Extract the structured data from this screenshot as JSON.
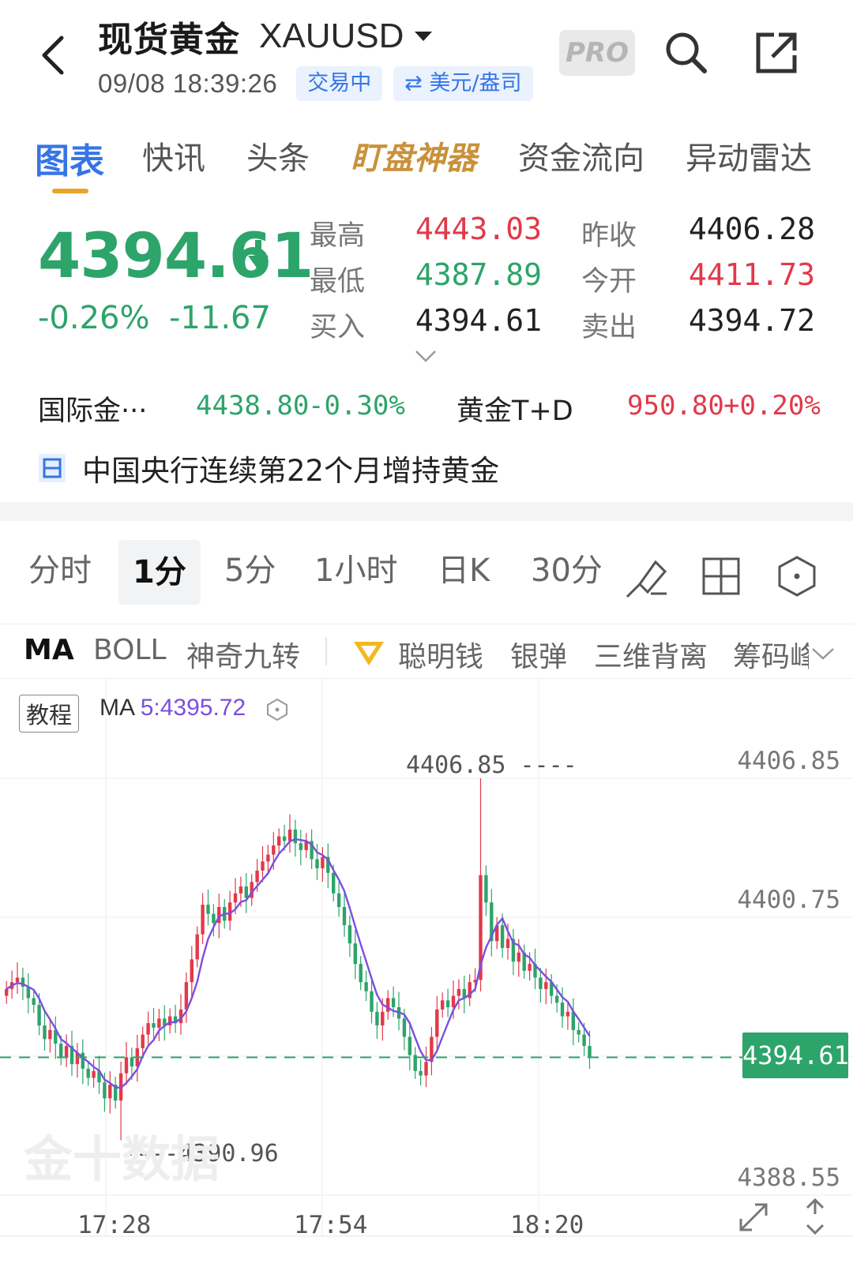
{
  "header": {
    "title": "现货黄金",
    "symbol": "XAUUSD",
    "time": "09/08 18:39:26",
    "status": "交易中",
    "unit": "⇄ 美元/盎司",
    "pro_label": "PRO"
  },
  "tabs": [
    {
      "label": "图表"
    },
    {
      "label": "快讯"
    },
    {
      "label": "头条"
    },
    {
      "label": "盯盘神器"
    },
    {
      "label": "资金流向"
    },
    {
      "label": "异动雷达"
    }
  ],
  "quote": {
    "price": "4394.61",
    "change_pct": "-0.26%",
    "change_abs": "-11.67",
    "stats": [
      {
        "label": "最高",
        "value": "4443.03",
        "color": "#e2394a"
      },
      {
        "label": "最低",
        "value": "4387.89",
        "color": "#2da46a"
      },
      {
        "label": "买入",
        "value": "4394.61",
        "color": "#222222"
      },
      {
        "label": "昨收",
        "value": "4406.28",
        "color": "#222222"
      },
      {
        "label": "今开",
        "value": "4411.73",
        "color": "#e2394a"
      },
      {
        "label": "卖出",
        "value": "4394.72",
        "color": "#222222"
      }
    ]
  },
  "related": [
    {
      "name": "国际金···",
      "price": "4438.80",
      "pct": "-0.30%",
      "color": "#2da46a"
    },
    {
      "name": "黄金T+D",
      "price": "950.80",
      "pct": "+0.20%",
      "color": "#e2394a"
    }
  ],
  "news": {
    "text": "中国央行连续第22个月增持黄金"
  },
  "periods": [
    {
      "label": "分时"
    },
    {
      "label": "1分"
    },
    {
      "label": "5分"
    },
    {
      "label": "1小时"
    },
    {
      "label": "日K"
    },
    {
      "label": "30分"
    }
  ],
  "indicators": [
    {
      "label": "MA"
    },
    {
      "label": "BOLL"
    },
    {
      "label": "神奇九转"
    },
    {
      "label": "聪明钱"
    },
    {
      "label": "银弹"
    },
    {
      "label": "三维背离"
    },
    {
      "label": "筹码峰"
    }
  ],
  "chart": {
    "tutorial_label": "教程",
    "ma_prefix": "MA ",
    "ma_value": "5:4395.72",
    "y_labels": [
      "4406.85",
      "4400.75",
      "4388.55"
    ],
    "current_price": "4394.61",
    "high_mark": "4406.85 ----",
    "low_mark": "----4390.96",
    "x_labels": [
      "17:28",
      "17:54",
      "18:20"
    ],
    "watermark": "金十数据"
  },
  "chart_data": {
    "type": "candlestick",
    "title": "",
    "xlabel": "",
    "ylabel": "",
    "ylim": [
      4388.55,
      4406.85
    ],
    "x_ticks": [
      "17:28",
      "17:54",
      "18:20"
    ],
    "ma_series_name": "MA5",
    "colors": {
      "up": "#e2394a",
      "down": "#2da46a",
      "ma": "#7a4fe0"
    },
    "close_series": [
      4397.6,
      4397.9,
      4398.1,
      4397.7,
      4397.2,
      4396.9,
      4396.0,
      4395.4,
      4395.8,
      4395.2,
      4394.6,
      4395.1,
      4394.3,
      4394.8,
      4394.1,
      4393.7,
      4394.0,
      4393.5,
      4392.8,
      4393.4,
      4392.7,
      4393.9,
      4394.6,
      4394.2,
      4395.0,
      4395.6,
      4396.1,
      4395.9,
      4396.3,
      4396.0,
      4396.4,
      4396.1,
      4396.7,
      4397.9,
      4398.9,
      4400.0,
      4401.3,
      4400.9,
      4400.5,
      4401.2,
      4400.6,
      4401.4,
      4401.8,
      4402.1,
      4401.6,
      4402.3,
      4402.8,
      4403.2,
      4403.5,
      4403.9,
      4404.3,
      4404.1,
      4404.6,
      4404.0,
      4403.7,
      4404.1,
      4403.3,
      4402.9,
      4403.4,
      4402.7,
      4401.8,
      4401.2,
      4400.4,
      4399.6,
      4398.7,
      4397.9,
      4397.5,
      4396.6,
      4396.0,
      4396.6,
      4397.2,
      4396.8,
      4396.3,
      4395.5,
      4394.7,
      4394.0,
      4393.8,
      4394.4,
      4395.5,
      4396.7,
      4397.1,
      4396.8,
      4397.3,
      4397.6,
      4397.2,
      4397.9,
      4398.0,
      4402.6,
      4401.4,
      4399.7,
      4400.4,
      4399.4,
      4399.8,
      4398.8,
      4399.2,
      4398.4,
      4398.7,
      4398.1,
      4397.6,
      4397.9,
      4397.3,
      4397.0,
      4396.4,
      4396.6,
      4395.8,
      4395.6,
      4395.1,
      4394.6
    ]
  }
}
